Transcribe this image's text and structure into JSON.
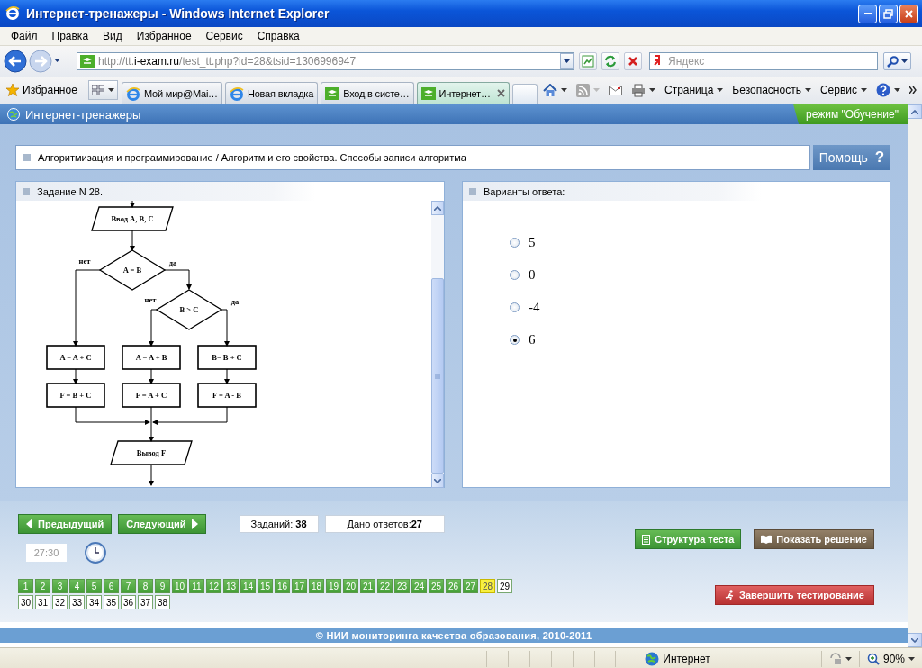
{
  "window": {
    "title": "Интернет-тренажеры - Windows Internet Explorer"
  },
  "menu": [
    "Файл",
    "Правка",
    "Вид",
    "Избранное",
    "Сервис",
    "Справка"
  ],
  "address": {
    "scheme": "http://tt.",
    "domain": "i-exam.ru",
    "path": "/test_tt.php?id=28&tsid=1306996947"
  },
  "search": {
    "placeholder": "Яндекс"
  },
  "favorites": "Избранное",
  "tabs": [
    {
      "label": "Мой мир@Mai…",
      "kind": "browser",
      "selected": false
    },
    {
      "label": "Новая вкладка",
      "kind": "browser",
      "selected": false
    },
    {
      "label": "Вход в систе…",
      "kind": "site",
      "selected": false
    },
    {
      "label": "Интернет…",
      "kind": "site",
      "selected": true
    }
  ],
  "toolbar": [
    "Страница",
    "Безопасность",
    "Сервис"
  ],
  "site": {
    "title": "Интернет-тренажеры",
    "mode": "режим \"Обучение\""
  },
  "breadcrumb": "Алгоритмизация и программирование / Алгоритм и его свойства. Способы записи алгоритма",
  "help": {
    "label": "Помощь",
    "mark": "?"
  },
  "task": {
    "title": "Задание N 28.",
    "nodes": [
      {
        "kind": "io",
        "text": "Ввод  A, B, C"
      },
      {
        "kind": "decision",
        "text": "A = B"
      },
      {
        "kind": "decision",
        "text": "B > C"
      },
      {
        "kind": "process",
        "text": "A = A + C"
      },
      {
        "kind": "process",
        "text": "A = A + B"
      },
      {
        "kind": "process",
        "text": "B= B + C"
      },
      {
        "kind": "process",
        "text": "F = B + C"
      },
      {
        "kind": "process",
        "text": "F = A + C"
      },
      {
        "kind": "process",
        "text": "F = A - B"
      },
      {
        "kind": "io",
        "text": "Вывод F"
      }
    ],
    "branch_labels": [
      "нет",
      "да",
      "нет",
      "да"
    ]
  },
  "answers": {
    "title": "Варианты ответа:",
    "options": [
      {
        "label": "5",
        "selected": false
      },
      {
        "label": "0",
        "selected": false
      },
      {
        "label": "-4",
        "selected": false
      },
      {
        "label": "6",
        "selected": true
      }
    ]
  },
  "nav": {
    "prev": "Предыдущий",
    "next": "Следующий",
    "tasks": "Заданий: **38**",
    "answered": "Дано ответов:**27**",
    "timer": "27:30",
    "structure": "Структура теста",
    "solution": "Показать решение",
    "finish": "Завершить тестирование"
  },
  "questions": [
    {
      "number": "1",
      "answered": true,
      "selected": false
    },
    {
      "number": "2",
      "answered": true,
      "selected": false
    },
    {
      "number": "3",
      "answered": true,
      "selected": false
    },
    {
      "number": "4",
      "answered": true,
      "selected": false
    },
    {
      "number": "5",
      "answered": true,
      "selected": false
    },
    {
      "number": "6",
      "answered": true,
      "selected": false
    },
    {
      "number": "7",
      "answered": true,
      "selected": false
    },
    {
      "number": "8",
      "answered": true,
      "selected": false
    },
    {
      "number": "9",
      "answered": true,
      "selected": false
    },
    {
      "number": "10",
      "answered": true,
      "selected": false
    },
    {
      "number": "11",
      "answered": true,
      "selected": false
    },
    {
      "number": "12",
      "answered": true,
      "selected": false
    },
    {
      "number": "13",
      "answered": true,
      "selected": false
    },
    {
      "number": "14",
      "answered": true,
      "selected": false
    },
    {
      "number": "15",
      "answered": true,
      "selected": false
    },
    {
      "number": "16",
      "answered": true,
      "selected": false
    },
    {
      "number": "17",
      "answered": true,
      "selected": false
    },
    {
      "number": "18",
      "answered": true,
      "selected": false
    },
    {
      "number": "19",
      "answered": true,
      "selected": false
    },
    {
      "number": "20",
      "answered": true,
      "selected": false
    },
    {
      "number": "21",
      "answered": true,
      "selected": false
    },
    {
      "number": "22",
      "answered": true,
      "selected": false
    },
    {
      "number": "23",
      "answered": true,
      "selected": false
    },
    {
      "number": "24",
      "answered": true,
      "selected": false
    },
    {
      "number": "25",
      "answered": true,
      "selected": false
    },
    {
      "number": "26",
      "answered": true,
      "selected": false
    },
    {
      "number": "27",
      "answered": true,
      "selected": false
    },
    {
      "number": "28",
      "answered": false,
      "selected": true
    },
    {
      "number": "29",
      "answered": false,
      "selected": false
    },
    {
      "number": "30",
      "answered": false,
      "selected": false
    },
    {
      "number": "31",
      "answered": false,
      "selected": false
    },
    {
      "number": "32",
      "answered": false,
      "selected": false
    },
    {
      "number": "33",
      "answered": false,
      "selected": false
    },
    {
      "number": "34",
      "answered": false,
      "selected": false
    },
    {
      "number": "35",
      "answered": false,
      "selected": false
    },
    {
      "number": "36",
      "answered": false,
      "selected": false
    },
    {
      "number": "37",
      "answered": false,
      "selected": false
    },
    {
      "number": "38",
      "answered": false,
      "selected": false
    }
  ],
  "footer": "© НИИ мониторинга качества образования, 2010-2011",
  "status_bar": {
    "zone": "Интернет",
    "zoom": "90%"
  }
}
